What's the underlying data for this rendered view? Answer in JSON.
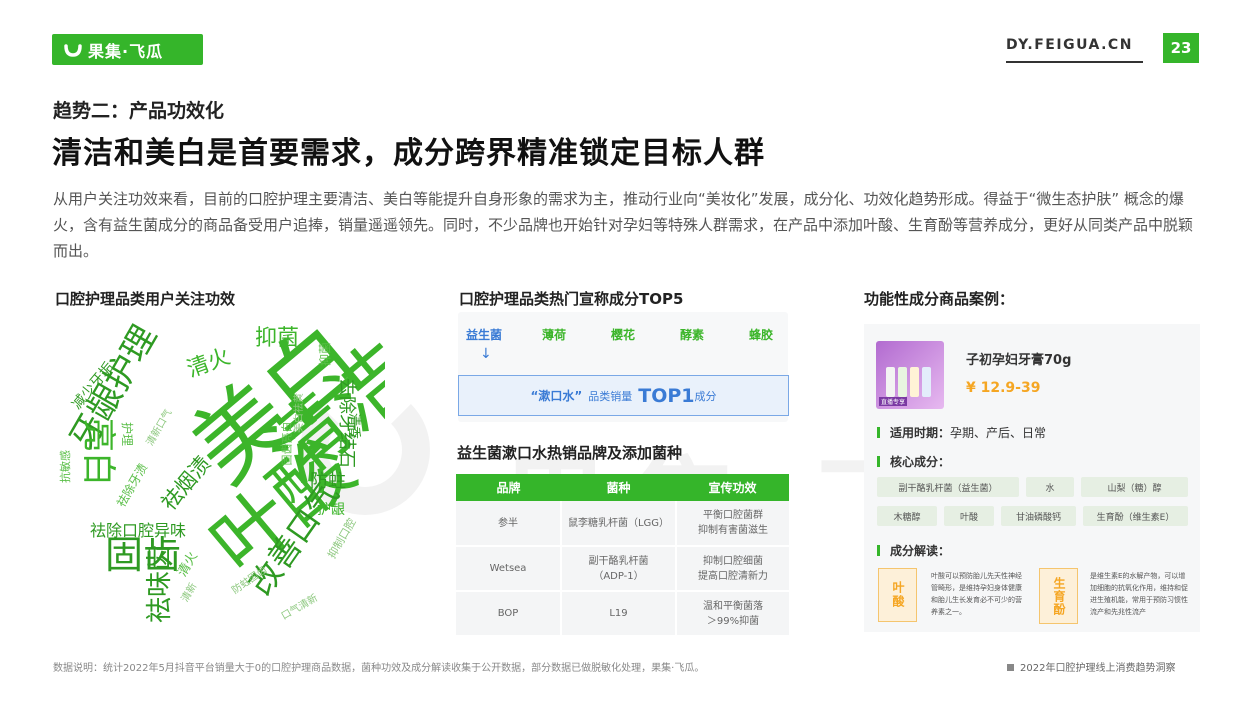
{
  "header": {
    "logo_text": "果集·飞瓜",
    "site_url": "DY.FEIGUA.CN",
    "page_number": "23"
  },
  "trend_label": "趋势二：产品功效化",
  "title": "清洁和美白是首要需求，成分跨界精准锁定目标人群",
  "intro": "从用户关注功效来看，目前的口腔护理主要清洁、美白等能提升自身形象的需求为主，推动行业向“美妆化”发展，成分化、功效化趋势形成。得益于“微生态护肤” 概念的爆火，含有益生菌成分的商品备受用户追捧，销量遥遥领先。同时，不少品牌也开始针对孕妇等特殊人群需求，在产品中添加叶酸、生育酚等营养成分，更好从同类产品中脱颖而出。",
  "word_cloud": {
    "heading": "口腔护理品类用户关注功效",
    "words": [
      "美白",
      "清洁",
      "叶酸",
      "牙龈护理",
      "固齿",
      "亮白",
      "改善口气",
      "祛除口腔异味",
      "祛烟渍",
      "祛味齿",
      "去除牙结石",
      "抑菌",
      "清火",
      "防蛀",
      "减少牙垢",
      "祛除牙渍",
      "抗敏感",
      "清新口气",
      "护龈",
      "固齿亮白",
      "清香",
      "抑制口腔",
      "口气清新",
      "防蛀固齿",
      "清火",
      "护理",
      "抑菌",
      "美白祛黄",
      "清新"
    ]
  },
  "top5": {
    "heading": "口腔护理品类热门宣称成分TOP5",
    "items": [
      "益生菌",
      "薄荷",
      "樱花",
      "酵素",
      "蜂胶"
    ],
    "arrow": "↓",
    "callout_pre": "“漱口水”",
    "callout_mid": "品类销量",
    "callout_big": "TOP1",
    "callout_post": "成分"
  },
  "table": {
    "heading": "益生菌漱口水热销品牌及添加菌种",
    "columns": [
      "品牌",
      "菌种",
      "宣传功效"
    ],
    "rows": [
      [
        "参半",
        "鼠李糖乳杆菌（LGG）",
        "平衡口腔菌群\n抑制有害菌滋生"
      ],
      [
        "Wetsea",
        "副干酪乳杆菌\n（ADP-1）",
        "抑制口腔细菌\n提高口腔清新力"
      ],
      [
        "BOP",
        "L19",
        "温和平衡菌落\n＞99%抑菌"
      ]
    ]
  },
  "case": {
    "heading": "功能性成分商品案例：",
    "product_name": "子初孕妇牙膏70g",
    "price": "¥ 12.9-39",
    "image_tag": "直播专享",
    "period_label": "适用时期：",
    "period_value": "孕期、产后、日常",
    "core_label": "核心成分：",
    "ingredients": [
      "副干酪乳杆菌（益生菌）",
      "水",
      "山梨（糖）醇",
      "木糖醇",
      "叶酸",
      "甘油磷酸钙",
      "生育酚（维生素E）"
    ],
    "analysis_label": "成分解读：",
    "nutrients": [
      {
        "name": "叶酸",
        "desc": "叶酸可以预防胎儿先天性神经管畸形，是维持孕妇身体健康和胎儿生长发育必不可少的营养素之一。"
      },
      {
        "name": "生育酚",
        "desc": "是维生素E的水解产物，可以增加细胞的抗氧化作用，维持和促进生殖机能，常用于预防习惯性流产和先兆性流产"
      }
    ]
  },
  "footer": {
    "note": "数据说明：统计2022年5月抖音平台销量大于0的口腔护理商品数据，菌种功效及成分解读收集于公开数据，部分数据已做脱敏化处理，果集·飞瓜。",
    "report": "2022年口腔护理线上消费趋势洞察"
  },
  "colors": {
    "brand_green": "#35b52a",
    "accent_blue": "#3a7bd5",
    "accent_orange": "#f5a623"
  }
}
